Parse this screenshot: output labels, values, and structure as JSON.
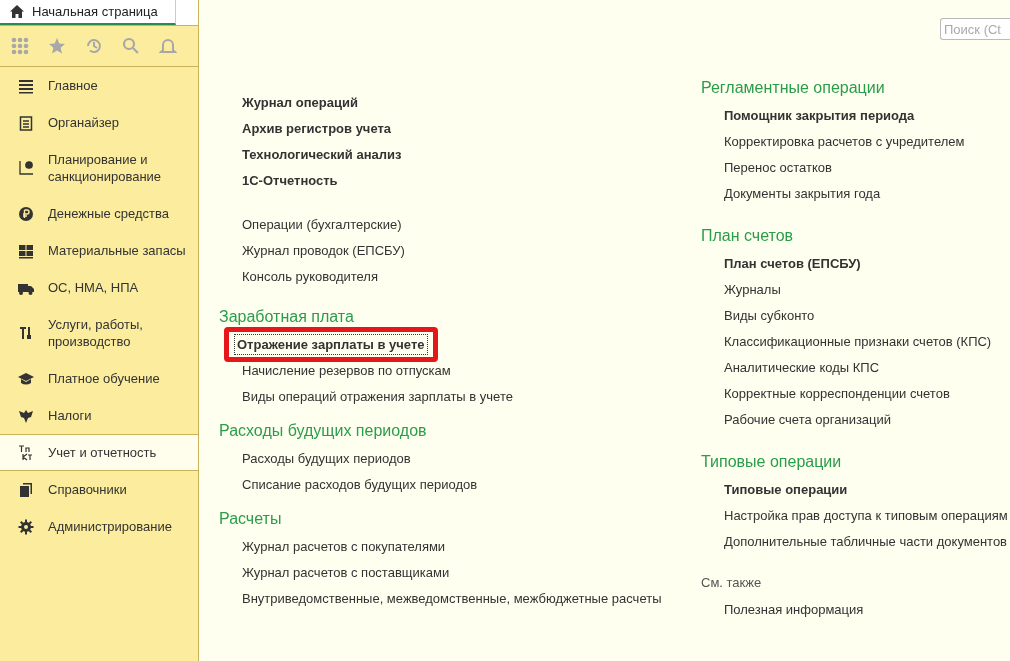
{
  "home_tab": {
    "label": "Начальная страница",
    "selected": true
  },
  "toolbar": {
    "placeholder": "Поиск (Ct"
  },
  "sidebar": {
    "items": [
      {
        "label": "Главное",
        "selected": false
      },
      {
        "label": "Органайзер",
        "selected": false
      },
      {
        "label": "Планирование и санкционирование",
        "selected": false
      },
      {
        "label": "Денежные средства",
        "selected": false
      },
      {
        "label": "Материальные запасы",
        "selected": false
      },
      {
        "label": "ОС, НМА, НПА",
        "selected": false
      },
      {
        "label": "Услуги, работы, производство",
        "selected": false
      },
      {
        "label": "Платное обучение",
        "selected": false
      },
      {
        "label": "Налоги",
        "selected": false
      },
      {
        "label": "Учет и отчетность",
        "selected": true
      },
      {
        "label": "Справочники",
        "selected": false
      },
      {
        "label": "Администрирование",
        "selected": false
      }
    ]
  },
  "columns": [
    {
      "sections": [
        {
          "links": [
            {
              "label": "Журнал операций",
              "bold": true,
              "highlighted": false
            },
            {
              "label": "Архив регистров учета",
              "bold": true,
              "highlighted": false
            },
            {
              "label": "Технологический анализ",
              "bold": true,
              "highlighted": false
            },
            {
              "label": "1С-Отчетность",
              "bold": true,
              "highlighted": false
            }
          ]
        },
        {
          "links": [
            {
              "label": "Операции (бухгалтерские)",
              "bold": false,
              "highlighted": false
            },
            {
              "label": "Журнал проводок (ЕПСБУ)",
              "bold": false,
              "highlighted": false
            },
            {
              "label": "Консоль руководителя",
              "bold": false,
              "highlighted": false
            }
          ]
        },
        {
          "title": "Заработная плата",
          "links": [
            {
              "label": "Отражение зарплаты в учете",
              "bold": true,
              "highlighted": true
            },
            {
              "label": "Начисление резервов по отпускам",
              "bold": false,
              "highlighted": false
            },
            {
              "label": "Виды операций отражения зарплаты в учете",
              "bold": false,
              "highlighted": false
            }
          ]
        },
        {
          "title": "Расходы будущих периодов",
          "links": [
            {
              "label": "Расходы будущих периодов",
              "bold": false,
              "highlighted": false
            },
            {
              "label": "Списание расходов будущих периодов",
              "bold": false,
              "highlighted": false
            }
          ]
        },
        {
          "title": "Расчеты",
          "links": [
            {
              "label": "Журнал расчетов с покупателями",
              "bold": false,
              "highlighted": false
            },
            {
              "label": "Журнал расчетов с поставщиками",
              "bold": false,
              "highlighted": false
            },
            {
              "label": "Внутриведомственные, межведомственные, межбюджетные расчеты",
              "bold": false,
              "highlighted": false
            }
          ]
        }
      ]
    },
    {
      "sections": [
        {
          "title": "Регламентные операции",
          "links": [
            {
              "label": "Помощник закрытия периода",
              "bold": true,
              "highlighted": false
            },
            {
              "label": "Корректировка расчетов с учредителем",
              "bold": false,
              "highlighted": false
            },
            {
              "label": "Перенос остатков",
              "bold": false,
              "highlighted": false
            },
            {
              "label": "Документы закрытия года",
              "bold": false,
              "highlighted": false
            }
          ]
        },
        {
          "title": "План счетов",
          "links": [
            {
              "label": "План счетов (ЕПСБУ)",
              "bold": true,
              "highlighted": false
            },
            {
              "label": "Журналы",
              "bold": false,
              "highlighted": false
            },
            {
              "label": "Виды субконто",
              "bold": false,
              "highlighted": false
            },
            {
              "label": "Классификационные признаки счетов (КПС)",
              "bold": false,
              "highlighted": false
            },
            {
              "label": "Аналитические коды КПС",
              "bold": false,
              "highlighted": false
            },
            {
              "label": "Корректные корреспонденции счетов",
              "bold": false,
              "highlighted": false
            },
            {
              "label": "Рабочие счета организаций",
              "bold": false,
              "highlighted": false
            }
          ]
        },
        {
          "title": "Типовые операции",
          "links": [
            {
              "label": "Типовые операции",
              "bold": true,
              "highlighted": false
            },
            {
              "label": "Настройка прав доступа к типовым операциям",
              "bold": false,
              "highlighted": false
            },
            {
              "label": "Дополнительные табличные части документов",
              "bold": false,
              "highlighted": false
            }
          ]
        },
        {
          "see_also": "См. также",
          "links": [
            {
              "label": "Полезная информация",
              "bold": false,
              "highlighted": false
            }
          ]
        }
      ]
    }
  ]
}
